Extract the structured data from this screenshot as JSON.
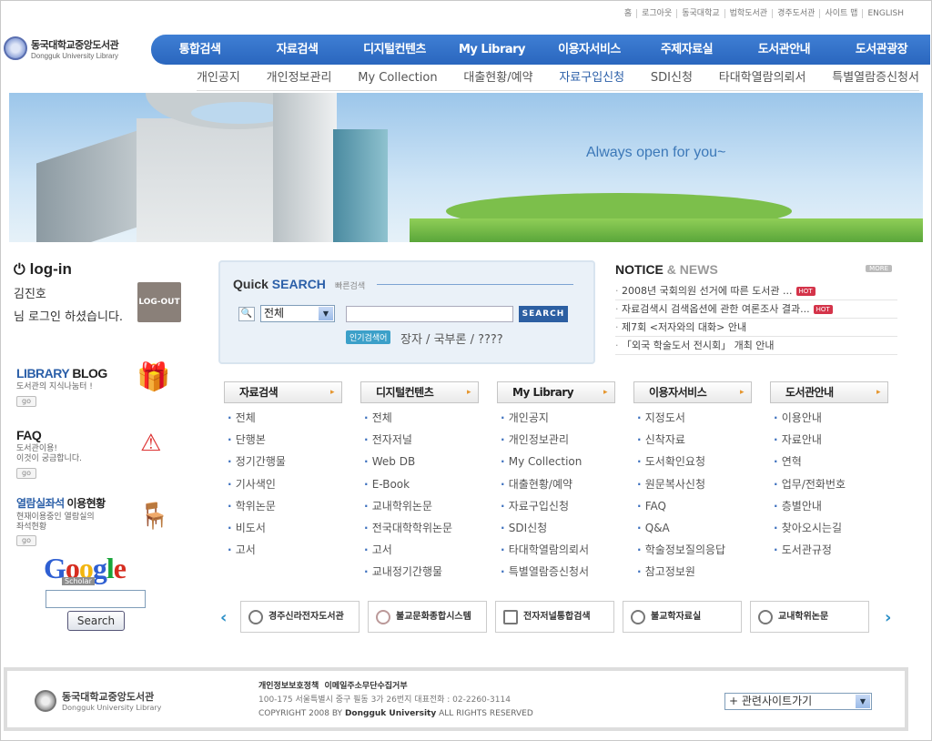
{
  "top_links": [
    "홈",
    "로그아웃",
    "동국대학교",
    "법학도서관",
    "경주도서관",
    "사이트 맵",
    "ENGLISH"
  ],
  "logo": {
    "ko": "동국대학교중앙도서관",
    "en": "Dongguk University Library"
  },
  "main_nav": [
    "통합검색",
    "자료검색",
    "디지털컨텐츠",
    "My Library",
    "이용자서비스",
    "주제자료실",
    "도서관안내",
    "도서관광장"
  ],
  "sub_nav": [
    "개인공지",
    "개인정보관리",
    "My Collection",
    "대출현황/예약",
    "자료구입신청",
    "SDI신청",
    "타대학열람의뢰서",
    "특별열람증신청서"
  ],
  "banner": {
    "slogan": "Always open for you~"
  },
  "login": {
    "title": "log-in",
    "name": "김진호",
    "message": "님 로그인 하셨습니다.",
    "logout_label": "LOG-OUT"
  },
  "side": {
    "blog_title_1": "LIBRARY",
    "blog_title_2": "BLOG",
    "blog_desc": "도서관의 지식나눔터 !",
    "faq_title": "FAQ",
    "faq_desc_1": "도서관이용!",
    "faq_desc_2": "이것이 궁금합니다.",
    "seat_title_1": "열람실좌석",
    "seat_title_2": "이용현황",
    "seat_desc_1": "현재이용중인 열람실의",
    "seat_desc_2": "좌석현황",
    "go": "go"
  },
  "google": {
    "g": "G",
    "o1": "o",
    "o2": "o",
    "g2": "g",
    "l": "l",
    "e": "e",
    "scholar": "Scholar",
    "search_label": "Search"
  },
  "quick_search": {
    "title_1": "Quick",
    "title_2": "SEARCH",
    "subtitle": "빠른검색",
    "scope": "전체",
    "search_button": "SEARCH",
    "popular_label": "인기검색어",
    "keywords": "장자 / 국부론 / ????"
  },
  "notice": {
    "title_1": "NOTICE",
    "title_2": "& NEWS",
    "more": "MORE",
    "items": [
      "2008년 국회의원 선거에 따른 도서관 ...",
      "자료검색시 검색옵션에 관한 여론조사 결과...",
      "제7회 <저자와의 대화> 안내",
      "「외국 학술도서 전시회」 개최 안내"
    ],
    "hot": "HOT"
  },
  "columns": [
    {
      "title": "자료검색",
      "items": [
        "전체",
        "단행본",
        "정기간행물",
        "기사색인",
        "학위논문",
        "비도서",
        "고서"
      ]
    },
    {
      "title": "디지털컨텐츠",
      "items": [
        "전체",
        "전자저널",
        "Web DB",
        "E-Book",
        "교내학위논문",
        "전국대학학위논문",
        "고서",
        "교내정기간행물"
      ]
    },
    {
      "title": "My Library",
      "items": [
        "개인공지",
        "개인정보관리",
        "My Collection",
        "대출현황/예약",
        "자료구입신청",
        "SDI신청",
        "타대학열람의뢰서",
        "특별열람증신청서"
      ]
    },
    {
      "title": "이용자서비스",
      "items": [
        "지정도서",
        "신착자료",
        "도서확인요청",
        "원문복사신청",
        "FAQ",
        "Q&A",
        "학술정보질의응답",
        "참고정보원"
      ]
    },
    {
      "title": "도서관안내",
      "items": [
        "이용안내",
        "자료안내",
        "연혁",
        "업무/전화번호",
        "층별안내",
        "찾아오시는길",
        "도서관규정"
      ]
    }
  ],
  "carousel": [
    "경주신라전자도서관",
    "불교문화종합시스템",
    "전자저널통합검색",
    "불교학자료실",
    "교내학위논문"
  ],
  "footer": {
    "logo_ko": "동국대학교중앙도서관",
    "logo_en": "Dongguk University Library",
    "link_1": "개인정보보호정책",
    "link_2": "이메일주소무단수집거부",
    "address": "100-175 서울특별시 중구 필동 3가 26번지  대표전화 : 02-2260-3114",
    "copy_1": "COPYRIGHT 2008 BY",
    "copy_2": "Dongguk University",
    "copy_3": "ALL RIGHTS RESERVED",
    "related_sites": "+ 관련사이트가기"
  }
}
